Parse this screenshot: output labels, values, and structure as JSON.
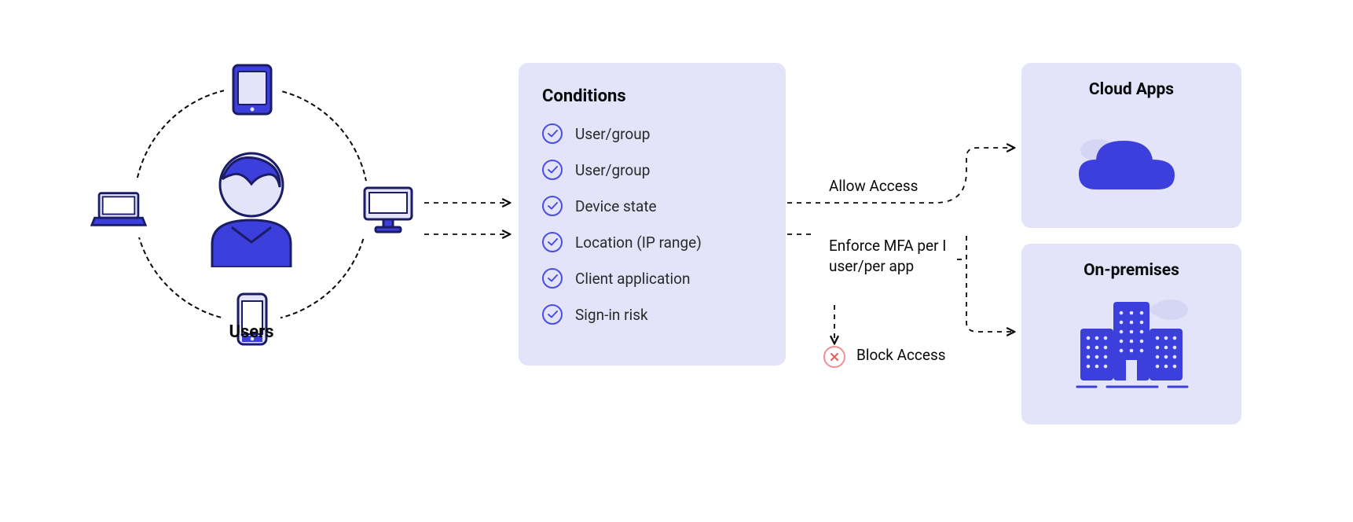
{
  "users": {
    "label": "Users",
    "devices": [
      "tablet",
      "desktop",
      "phone",
      "laptop"
    ]
  },
  "conditions": {
    "title": "Conditions",
    "items": [
      "User/group",
      "User/group",
      "Device state",
      "Location (IP range)",
      "Client application",
      "Sign-in risk"
    ]
  },
  "outcomes": {
    "allow": "Allow Access",
    "enforce": "Enforce MFA per I user/per app",
    "block": "Block Access"
  },
  "destinations": {
    "cloud": "Cloud Apps",
    "onprem": "On-premises"
  },
  "colors": {
    "accent": "#3d3fdd",
    "outline": "#1a1c66",
    "chipFill": "#e3e4f9",
    "lightLavender": "#d5d6f3",
    "danger": "#e85c5c"
  }
}
